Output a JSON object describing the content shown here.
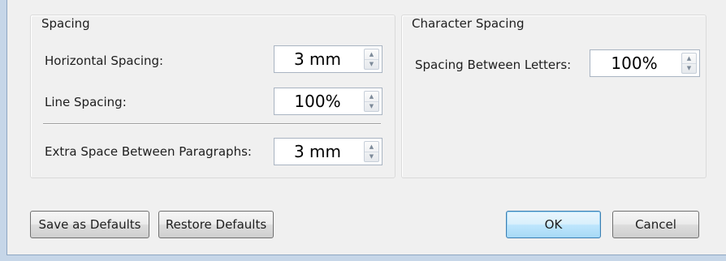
{
  "spacing_group": {
    "title": "Spacing",
    "horizontal_spacing": {
      "label": "Horizontal Spacing:",
      "value": "3 mm"
    },
    "line_spacing": {
      "label": "Line Spacing:",
      "value": "100%"
    },
    "extra_space": {
      "label": "Extra Space Between Paragraphs:",
      "value": "3 mm"
    }
  },
  "character_group": {
    "title": "Character Spacing",
    "letters": {
      "label": "Spacing Between Letters:",
      "value": "100%"
    }
  },
  "buttons": {
    "save_defaults": "Save as Defaults",
    "restore_defaults": "Restore Defaults",
    "ok": "OK",
    "cancel": "Cancel"
  },
  "icons": {
    "spin_up": "▲",
    "spin_down": "▼"
  },
  "colors": {
    "dialog_bg": "#f0f0f0",
    "window_frame": "#c6d6e8",
    "default_button": "#bee6fd"
  }
}
